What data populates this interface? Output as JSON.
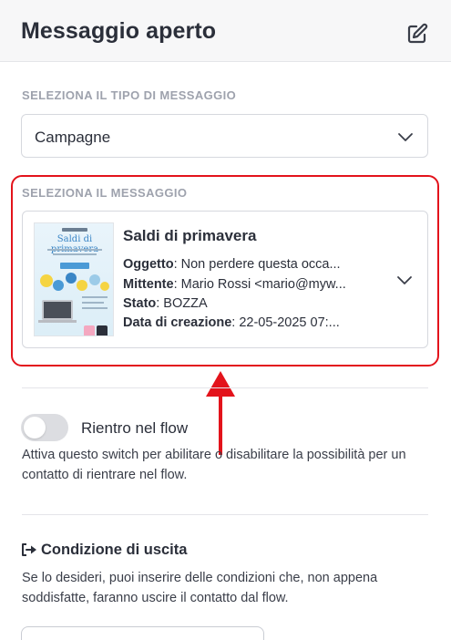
{
  "header": {
    "title": "Messaggio aperto",
    "edit_icon": "edit-icon"
  },
  "message_type": {
    "label": "SELEZIONA IL TIPO DI MESSAGGIO",
    "selected": "Campagne",
    "chevron_icon": "chevron-down-icon"
  },
  "message": {
    "label": "SELEZIONA IL MESSAGGIO",
    "thumbnail_title": "Saldi di primavera",
    "title": "Saldi di primavera",
    "subject_label": "Oggetto",
    "subject_value": ": Non perdere questa occa...",
    "sender_label": "Mittente",
    "sender_value": ": Mario Rossi <mario@myw...",
    "status_label": "Stato",
    "status_value": ": BOZZA",
    "created_label": "Data di creazione",
    "created_value": ": 22-05-2025 07:..."
  },
  "reentry": {
    "toggle_on": false,
    "label": "Rientro nel flow",
    "description": "Attiva questo switch per abilitare o disabilitare la possibilità per un contatto di rientrare nel flow."
  },
  "exit_condition": {
    "icon": "exit-icon",
    "title": "Condizione di uscita",
    "description": "Se lo desideri, puoi inserire delle condizioni che, non appena soddisfatte, faranno uscire il contatto dal flow."
  },
  "colors": {
    "highlight": "#e3131b",
    "text": "#2b2f3a",
    "label_grey": "#9ea2ad",
    "header_bg": "#f7f7f8"
  }
}
